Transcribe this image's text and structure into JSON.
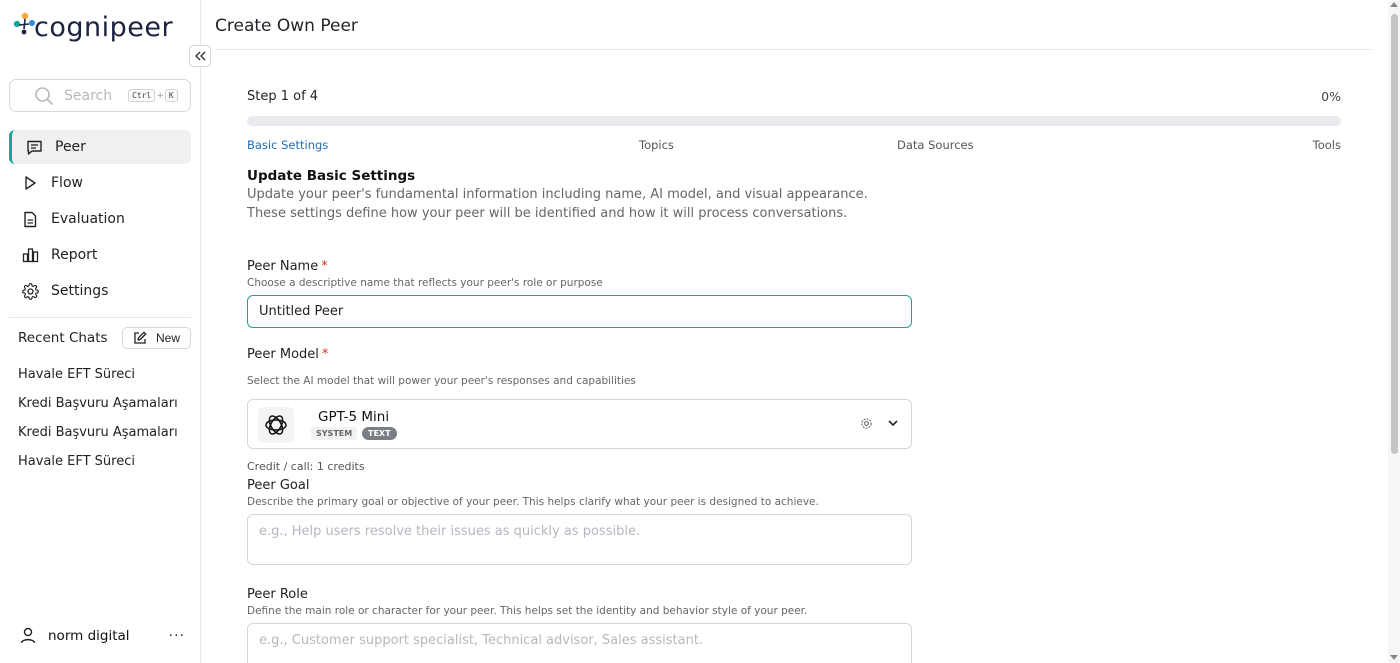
{
  "app": {
    "logo_text": "cognipeer",
    "accent_color": "#1aa39a"
  },
  "sidebar": {
    "collapse_icon": "double-chevron-left-icon",
    "search": {
      "placeholder": "Search",
      "shortcut_mod": "Ctrl",
      "shortcut_plus": "+",
      "shortcut_key": "K"
    },
    "nav": [
      {
        "label": "Peer",
        "icon": "chat-icon",
        "active": true
      },
      {
        "label": "Flow",
        "icon": "play-icon",
        "active": false
      },
      {
        "label": "Evaluation",
        "icon": "document-icon",
        "active": false
      },
      {
        "label": "Report",
        "icon": "bar-chart-icon",
        "active": false
      },
      {
        "label": "Settings",
        "icon": "gear-icon",
        "active": false
      }
    ],
    "recent_chats": {
      "title": "Recent Chats",
      "new_label": "New",
      "items": [
        "Havale EFT Süreci",
        "Kredi Başvuru Aşamaları",
        "Kredi Başvuru Aşamaları",
        "Havale EFT Süreci"
      ]
    },
    "user": {
      "name": "norm digital",
      "menu": "···"
    }
  },
  "main": {
    "page_title": "Create Own Peer",
    "wizard": {
      "step_label": "Step 1 of 4",
      "progress_percent_label": "0%",
      "progress": 0,
      "steps": [
        "Basic Settings",
        "Topics",
        "Data Sources",
        "Tools"
      ],
      "active_step": 0
    },
    "section": {
      "title": "Update Basic Settings",
      "description": "Update your peer's fundamental information including name, AI model, and visual appearance. These settings define how your peer will be identified and how it will process conversations."
    },
    "fields": {
      "peer_name": {
        "label": "Peer Name",
        "required_mark": "*",
        "help": "Choose a descriptive name that reflects your peer's role or purpose",
        "value": "Untitled Peer"
      },
      "peer_model": {
        "label": "Peer Model",
        "required_mark": "*",
        "help": "Select the AI model that will power your peer's responses and capabilities",
        "model_name": "GPT-5 Mini",
        "badge_system": "SYSTEM",
        "badge_text": "TEXT",
        "credit": "Credit / call: 1 credits"
      },
      "peer_goal": {
        "label": "Peer Goal",
        "help": "Describe the primary goal or objective of your peer. This helps clarify what your peer is designed to achieve.",
        "placeholder": "e.g., Help users resolve their issues as quickly as possible."
      },
      "peer_role": {
        "label": "Peer Role",
        "help": "Define the main role or character for your peer. This helps set the identity and behavior style of your peer.",
        "placeholder": "e.g., Customer support specialist, Technical advisor, Sales assistant."
      }
    }
  }
}
